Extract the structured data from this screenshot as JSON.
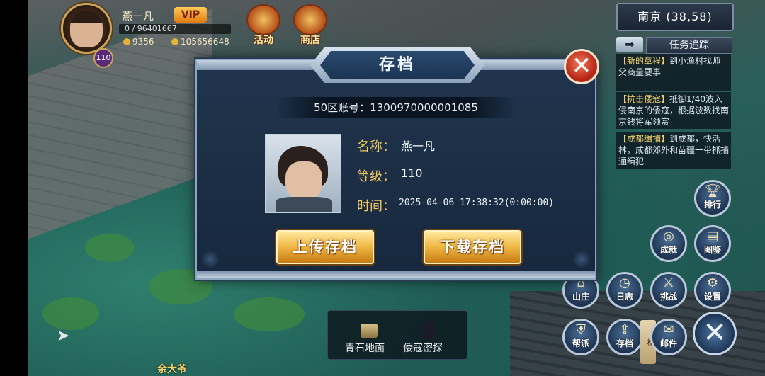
{
  "player": {
    "name": "燕一凡",
    "vip": "VIP",
    "exp": "0 / 96401667",
    "level": "110",
    "currency1": "9356",
    "currency2": "105656648"
  },
  "top_icons": {
    "activity": "活动",
    "shop": "商店"
  },
  "location": "南京 (38,58)",
  "quest_tracker": {
    "title": "任务追踪",
    "quests": [
      {
        "tag": "【新的章程】",
        "text": "到小渔村找师父商量要事"
      },
      {
        "tag": "【抗击倭寇】",
        "text": "抵御1/40波入侵南京的倭寇，根据波数找南京钱将军领赏"
      },
      {
        "tag": "【成都缉捕】",
        "text": "到成都，快活林，成都郊外和苗疆一带抓捕通缉犯"
      }
    ]
  },
  "dialog": {
    "title": "存档",
    "account": "50区账号：1300970000001085",
    "labels": {
      "name": "名称：",
      "level": "等级：",
      "time": "时间："
    },
    "values": {
      "name": "燕一凡",
      "level": "110",
      "time": "2025-04-06 17:38:32(0:00:00)"
    },
    "upload_button": "上传存档",
    "download_button": "下载存档",
    "close_symbol": "✕"
  },
  "side_buttons": {
    "rank": "排行",
    "achievement": "成就",
    "atlas": "图鉴",
    "villa": "山庄",
    "log": "日志",
    "challenge": "挑战",
    "settings": "设置",
    "faction": "帮派",
    "save": "存档",
    "mail": "邮件"
  },
  "tower_tag": "楼",
  "bottom_bar": {
    "item1": "青石地面",
    "item2": "倭寇密探"
  },
  "npc_name": "余大爷",
  "close_main": "✕"
}
